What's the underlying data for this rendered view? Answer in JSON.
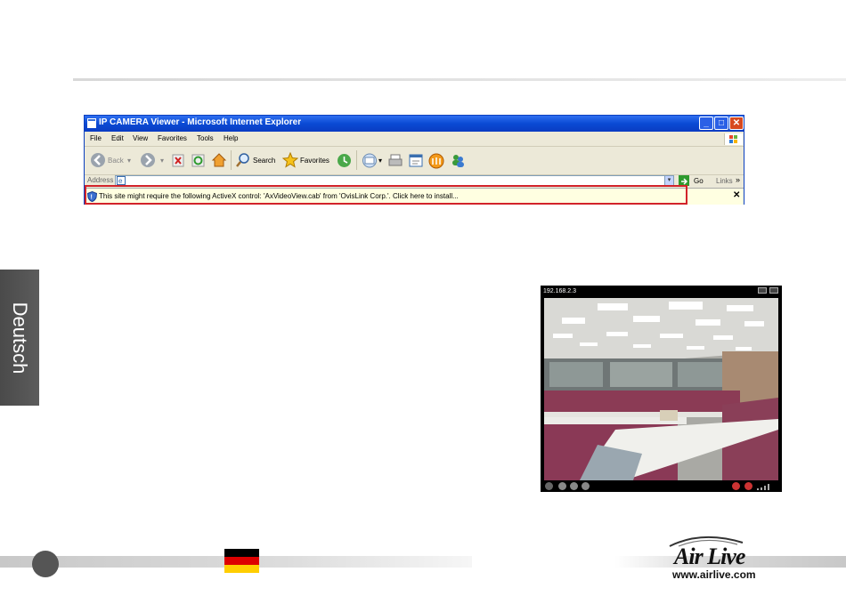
{
  "side_tab": {
    "label": "Deutsch"
  },
  "browser": {
    "title": "IP CAMERA Viewer - Microsoft Internet Explorer",
    "menu": [
      "File",
      "Edit",
      "View",
      "Favorites",
      "Tools",
      "Help"
    ],
    "toolbar": {
      "back": "Back",
      "search": "Search",
      "favorites": "Favorites"
    },
    "address": {
      "label": "Address",
      "value": "",
      "go": "Go",
      "links": "Links"
    },
    "infobar": {
      "message": "This site might require the following ActiveX control: 'AxVideoView.cab' from 'OvisLink Corp.'. Click here to install...",
      "close": "✕"
    }
  },
  "camera": {
    "ip": "192.168.2.3"
  },
  "footer": {
    "brand": "Air Live",
    "url": "www.airlive.com"
  },
  "colors": {
    "highlight": "#d2232a",
    "titlebar": "#0a4ad4",
    "sidetab": "#555555"
  }
}
